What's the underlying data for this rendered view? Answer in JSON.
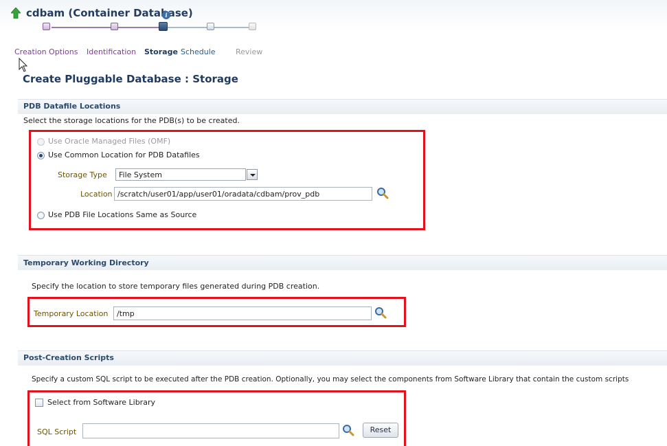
{
  "header": {
    "title": "cdbam (Container Database)",
    "info_icon": "info-icon",
    "up_icon": "green-up-arrow-icon"
  },
  "train": {
    "steps": [
      {
        "label": "Creation Options",
        "state": "visited"
      },
      {
        "label": "Identification",
        "state": "visited"
      },
      {
        "label": "Storage",
        "state": "current"
      },
      {
        "label": "Schedule",
        "state": "next"
      },
      {
        "label": "Review",
        "state": "disabled"
      }
    ]
  },
  "page": {
    "title": "Create Pluggable Database : Storage"
  },
  "datafile": {
    "section_title": "PDB Datafile Locations",
    "description": "Select the storage locations for the PDB(s) to be created.",
    "options": [
      {
        "label": "Use Oracle Managed Files (OMF)",
        "checked": false,
        "disabled": true
      },
      {
        "label": "Use Common Location for PDB Datafiles",
        "checked": true,
        "disabled": false
      },
      {
        "label": "Use PDB File Locations Same as Source",
        "checked": false,
        "disabled": false
      }
    ],
    "storage_type_label": "Storage Type",
    "storage_type_value": "File System",
    "location_label": "Location",
    "location_value": "/scratch/user01/app/user01/oradata/cdbam/prov_pdb"
  },
  "temp": {
    "section_title": "Temporary Working Directory",
    "description": "Specify the location to store temporary files generated during PDB creation.",
    "location_label": "Temporary Location",
    "location_value": "/tmp"
  },
  "scripts": {
    "section_title": "Post-Creation Scripts",
    "description": "Specify a custom SQL script to be executed after the PDB creation. Optionally, you may select the components from Software Library that contain the custom scripts",
    "checkbox_label": "Select from Software Library",
    "checkbox_checked": false,
    "sql_label": "SQL Script",
    "sql_value": "",
    "reset_label": "Reset"
  },
  "colors": {
    "highlight": "#e5101b",
    "title": "#243d5e",
    "train_visited": "#8a5a9e",
    "train_current": "#1f3a5f",
    "field_label": "#6b5300"
  }
}
